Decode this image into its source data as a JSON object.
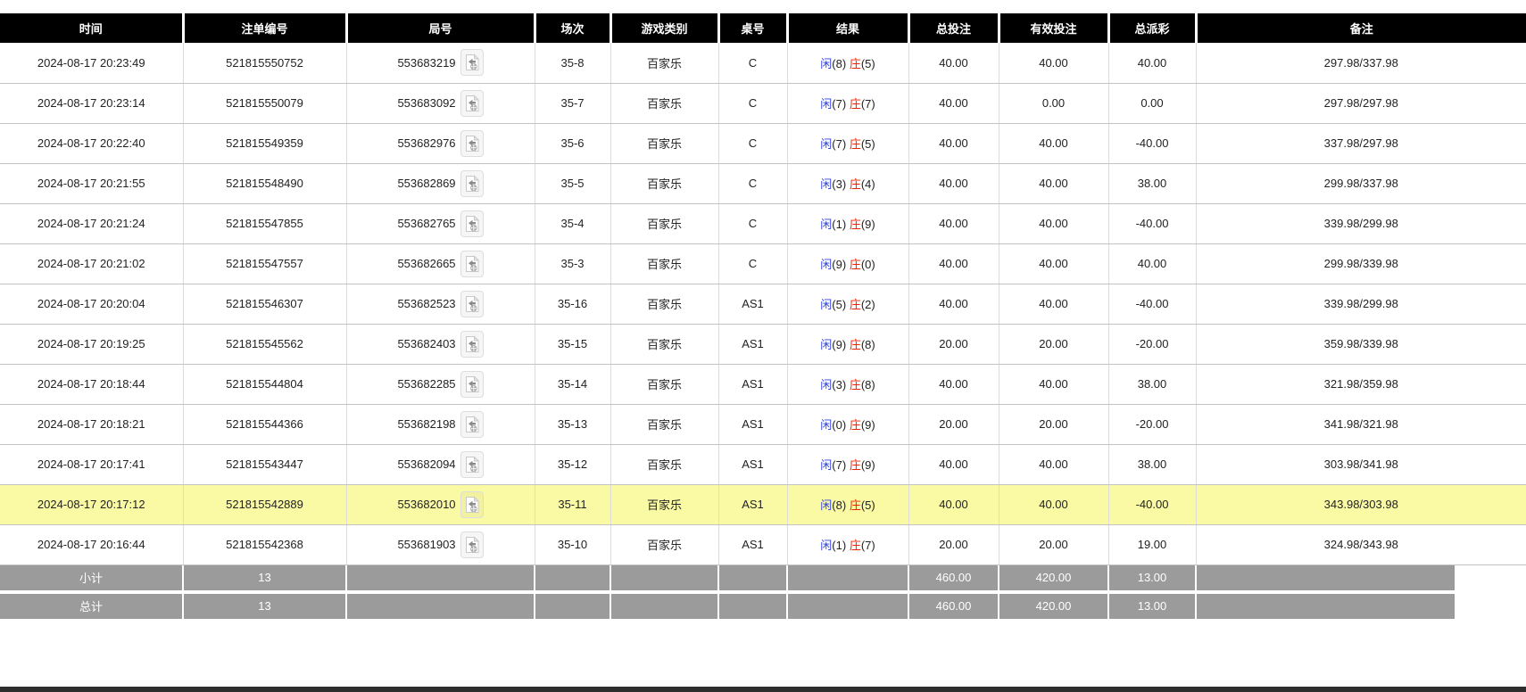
{
  "colors": {
    "header_bg": "#000000",
    "header_text": "#ffffff",
    "amount_blue": "#1166ee",
    "player_blue": "#3344dd",
    "banker_red": "#ee2200",
    "negative_red": "#ff1111",
    "highlight_yellow": "#fafaa5",
    "summary_bg": "#9b9b9b"
  },
  "header": {
    "columns": [
      "时间",
      "注单编号",
      "局号",
      "场次",
      "游戏类别",
      "桌号",
      "结果",
      "总投注",
      "有效投注",
      "总派彩",
      "备注"
    ]
  },
  "result_labels": {
    "player": "闲",
    "banker": "庄"
  },
  "icons": {
    "round_action": "video-replay-icon"
  },
  "rows": [
    {
      "time": "2024-08-17 20:23:49",
      "bet_id": "521815550752",
      "round_id": "553683219",
      "session": "35-8",
      "game": "百家乐",
      "table": "C",
      "player": "8",
      "banker": "5",
      "total_bet": "40.00",
      "valid_bet": "40.00",
      "payout": "40.00",
      "remark": "297.98/337.98",
      "highlighted": false
    },
    {
      "time": "2024-08-17 20:23:14",
      "bet_id": "521815550079",
      "round_id": "553683092",
      "session": "35-7",
      "game": "百家乐",
      "table": "C",
      "player": "7",
      "banker": "7",
      "total_bet": "40.00",
      "valid_bet": "0.00",
      "payout": "0.00",
      "remark": "297.98/297.98",
      "highlighted": false
    },
    {
      "time": "2024-08-17 20:22:40",
      "bet_id": "521815549359",
      "round_id": "553682976",
      "session": "35-6",
      "game": "百家乐",
      "table": "C",
      "player": "7",
      "banker": "5",
      "total_bet": "40.00",
      "valid_bet": "40.00",
      "payout": "-40.00",
      "remark": "337.98/297.98",
      "highlighted": false
    },
    {
      "time": "2024-08-17 20:21:55",
      "bet_id": "521815548490",
      "round_id": "553682869",
      "session": "35-5",
      "game": "百家乐",
      "table": "C",
      "player": "3",
      "banker": "4",
      "total_bet": "40.00",
      "valid_bet": "40.00",
      "payout": "38.00",
      "remark": "299.98/337.98",
      "highlighted": false
    },
    {
      "time": "2024-08-17 20:21:24",
      "bet_id": "521815547855",
      "round_id": "553682765",
      "session": "35-4",
      "game": "百家乐",
      "table": "C",
      "player": "1",
      "banker": "9",
      "total_bet": "40.00",
      "valid_bet": "40.00",
      "payout": "-40.00",
      "remark": "339.98/299.98",
      "highlighted": false
    },
    {
      "time": "2024-08-17 20:21:02",
      "bet_id": "521815547557",
      "round_id": "553682665",
      "session": "35-3",
      "game": "百家乐",
      "table": "C",
      "player": "9",
      "banker": "0",
      "total_bet": "40.00",
      "valid_bet": "40.00",
      "payout": "40.00",
      "remark": "299.98/339.98",
      "highlighted": false
    },
    {
      "time": "2024-08-17 20:20:04",
      "bet_id": "521815546307",
      "round_id": "553682523",
      "session": "35-16",
      "game": "百家乐",
      "table": "AS1",
      "player": "5",
      "banker": "2",
      "total_bet": "40.00",
      "valid_bet": "40.00",
      "payout": "-40.00",
      "remark": "339.98/299.98",
      "highlighted": false
    },
    {
      "time": "2024-08-17 20:19:25",
      "bet_id": "521815545562",
      "round_id": "553682403",
      "session": "35-15",
      "game": "百家乐",
      "table": "AS1",
      "player": "9",
      "banker": "8",
      "total_bet": "20.00",
      "valid_bet": "20.00",
      "payout": "-20.00",
      "remark": "359.98/339.98",
      "highlighted": false
    },
    {
      "time": "2024-08-17 20:18:44",
      "bet_id": "521815544804",
      "round_id": "553682285",
      "session": "35-14",
      "game": "百家乐",
      "table": "AS1",
      "player": "3",
      "banker": "8",
      "total_bet": "40.00",
      "valid_bet": "40.00",
      "payout": "38.00",
      "remark": "321.98/359.98",
      "highlighted": false
    },
    {
      "time": "2024-08-17 20:18:21",
      "bet_id": "521815544366",
      "round_id": "553682198",
      "session": "35-13",
      "game": "百家乐",
      "table": "AS1",
      "player": "0",
      "banker": "9",
      "total_bet": "20.00",
      "valid_bet": "20.00",
      "payout": "-20.00",
      "remark": "341.98/321.98",
      "highlighted": false
    },
    {
      "time": "2024-08-17 20:17:41",
      "bet_id": "521815543447",
      "round_id": "553682094",
      "session": "35-12",
      "game": "百家乐",
      "table": "AS1",
      "player": "7",
      "banker": "9",
      "total_bet": "40.00",
      "valid_bet": "40.00",
      "payout": "38.00",
      "remark": "303.98/341.98",
      "highlighted": false
    },
    {
      "time": "2024-08-17 20:17:12",
      "bet_id": "521815542889",
      "round_id": "553682010",
      "session": "35-11",
      "game": "百家乐",
      "table": "AS1",
      "player": "8",
      "banker": "5",
      "total_bet": "40.00",
      "valid_bet": "40.00",
      "payout": "-40.00",
      "remark": "343.98/303.98",
      "highlighted": true
    },
    {
      "time": "2024-08-17 20:16:44",
      "bet_id": "521815542368",
      "round_id": "553681903",
      "session": "35-10",
      "game": "百家乐",
      "table": "AS1",
      "player": "1",
      "banker": "7",
      "total_bet": "20.00",
      "valid_bet": "20.00",
      "payout": "19.00",
      "remark": "324.98/343.98",
      "highlighted": false
    }
  ],
  "summary_rows": [
    {
      "label": "小计",
      "count": "13",
      "total_bet": "460.00",
      "valid_bet": "420.00",
      "payout": "13.00"
    },
    {
      "label": "总计",
      "count": "13",
      "total_bet": "460.00",
      "valid_bet": "420.00",
      "payout": "13.00"
    }
  ]
}
